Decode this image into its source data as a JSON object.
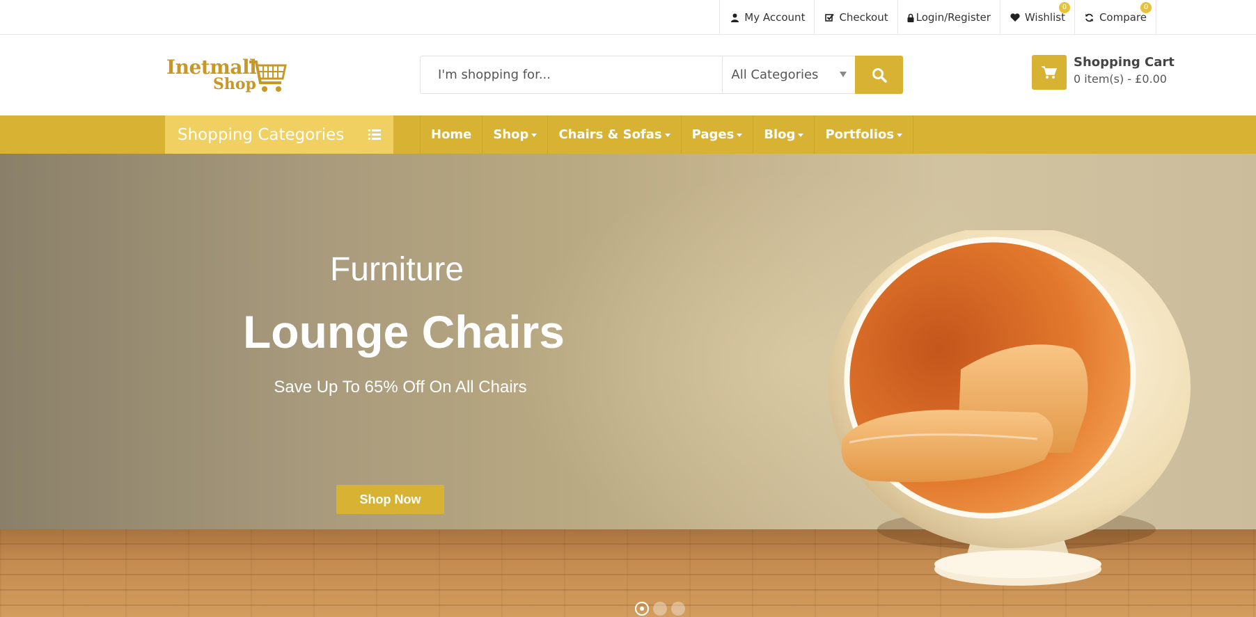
{
  "topbar": {
    "links": [
      {
        "label": "My Account",
        "icon": "user-icon"
      },
      {
        "label": "Checkout",
        "icon": "check-square-icon"
      },
      {
        "label": "Login/Register",
        "icon": "lock-icon"
      },
      {
        "label": "Wishlist",
        "icon": "heart-icon",
        "badge": "0"
      },
      {
        "label": "Compare",
        "icon": "refresh-icon",
        "badge": "0"
      }
    ]
  },
  "header": {
    "logo_line1": "Inetmall",
    "logo_line2": "Shop",
    "search_placeholder": "I'm shopping for...",
    "category_selected": "All Categories",
    "cart_title": "Shopping Cart",
    "cart_summary": "0 item(s) - £0.00"
  },
  "nav": {
    "categories_label": "Shopping Categories",
    "menu": [
      {
        "label": "Home",
        "dropdown": false
      },
      {
        "label": "Shop",
        "dropdown": true
      },
      {
        "label": "Chairs & Sofas",
        "dropdown": true
      },
      {
        "label": "Pages",
        "dropdown": true
      },
      {
        "label": "Blog",
        "dropdown": true
      },
      {
        "label": "Portfolios",
        "dropdown": true
      }
    ]
  },
  "hero": {
    "kicker": "Furniture",
    "headline": "Lounge Chairs",
    "subline": "Save Up To 65% Off On All Chairs",
    "cta": "Shop Now",
    "slides": 3,
    "active_slide": 1
  },
  "colors": {
    "accent": "#d7b233",
    "accent_light": "#f0d060",
    "badge": "#e8c234",
    "logo": "#c99723"
  }
}
